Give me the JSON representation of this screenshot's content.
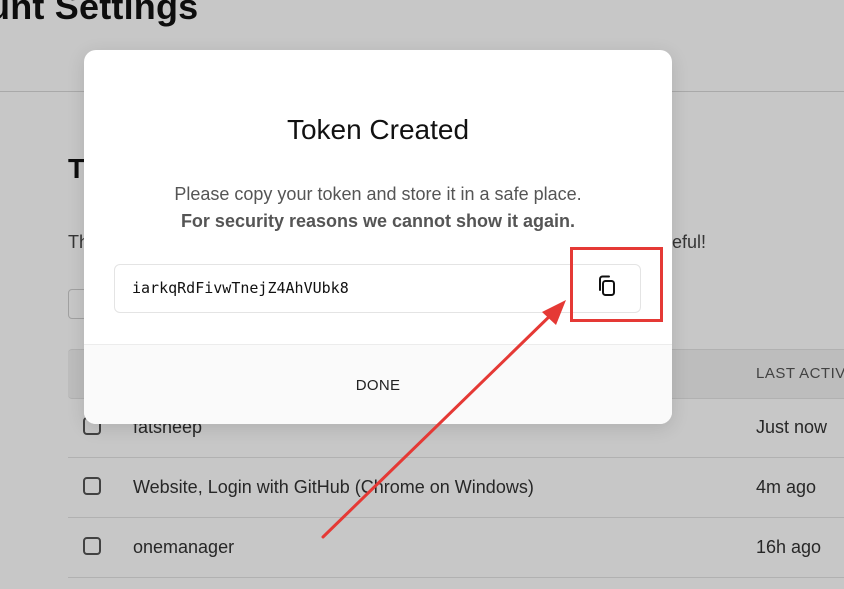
{
  "page": {
    "title": "unt Settings",
    "section_title": "T",
    "section_desc_start": "Th",
    "section_desc_end": "eful!"
  },
  "table": {
    "columns": {
      "last_active": "LAST ACTIVE"
    },
    "rows": [
      {
        "name": "fatsheep",
        "last_active": "Just now"
      },
      {
        "name": "Website, Login with GitHub (Chrome on Windows)",
        "last_active": "4m ago"
      },
      {
        "name": "onemanager",
        "last_active": "16h ago"
      }
    ]
  },
  "modal": {
    "title": "Token Created",
    "line1": "Please copy your token and store it in a safe place.",
    "line2": "For security reasons we cannot show it again.",
    "token": "iarkqRdFivwTnejZ4AhVUbk8",
    "copy_icon": "copy-icon",
    "done_label": "DONE"
  },
  "annotation": {
    "color": "#e53935"
  }
}
